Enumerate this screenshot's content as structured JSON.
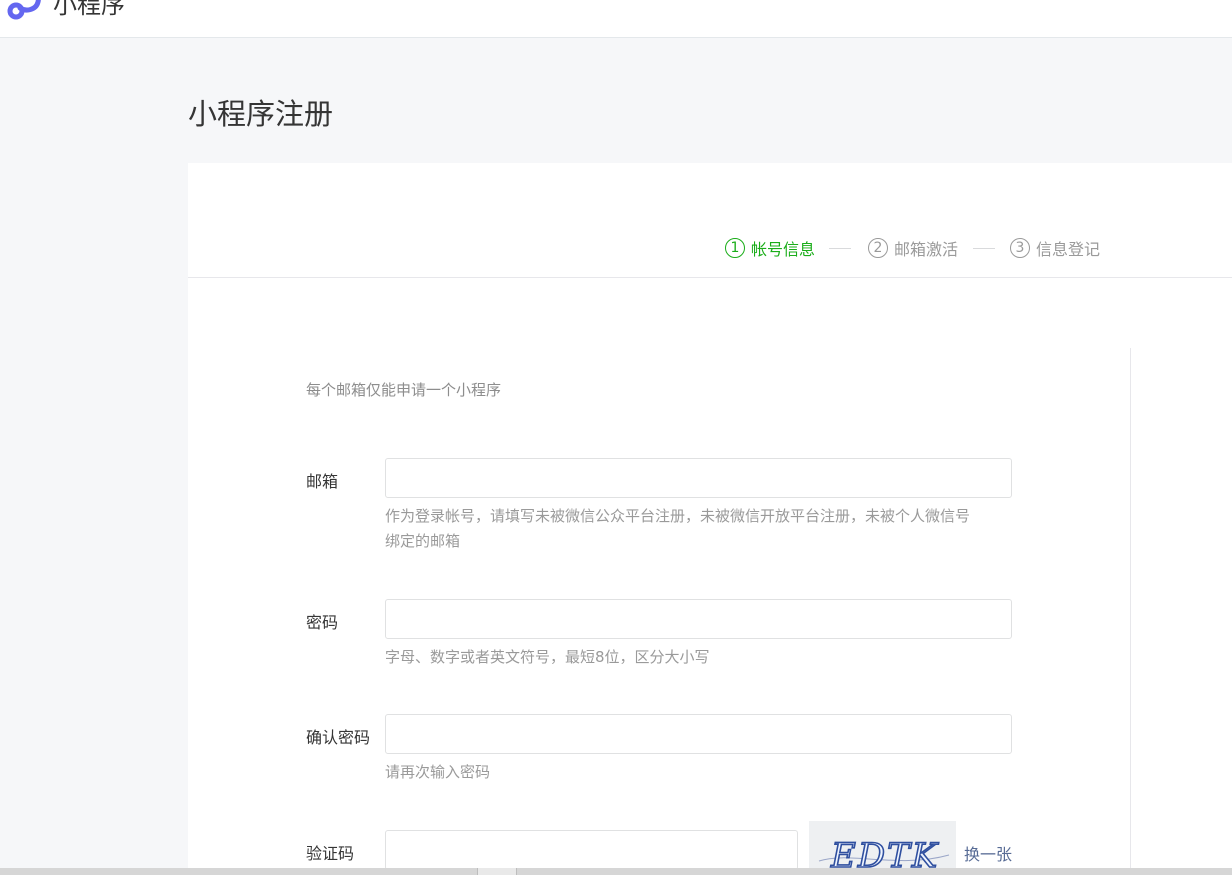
{
  "header": {
    "brand_name": "小程序",
    "logo_icon": "miniprogram-logo-icon"
  },
  "page": {
    "title": "小程序注册"
  },
  "steps": [
    {
      "number": "1",
      "label": "帐号信息",
      "active": true
    },
    {
      "number": "2",
      "label": "邮箱激活",
      "active": false
    },
    {
      "number": "3",
      "label": "信息登记",
      "active": false
    }
  ],
  "form": {
    "notice": "每个邮箱仅能申请一个小程序",
    "email": {
      "label": "邮箱",
      "value": "",
      "hint_line1": "作为登录帐号，请填写未被微信公众平台注册，未被微信开放平台注册，未被个人微信号",
      "hint_line2": "绑定的邮箱"
    },
    "password": {
      "label": "密码",
      "value": "",
      "hint": "字母、数字或者英文符号，最短8位，区分大小写"
    },
    "confirm_password": {
      "label": "确认密码",
      "value": "",
      "hint": "请再次输入密码"
    },
    "captcha": {
      "label": "验证码",
      "value": "",
      "image_text": "EDTK",
      "refresh_label": "换一张"
    }
  },
  "colors": {
    "accent_green": "#1aad19",
    "link_blue": "#576b95",
    "logo": "#6467f0"
  }
}
